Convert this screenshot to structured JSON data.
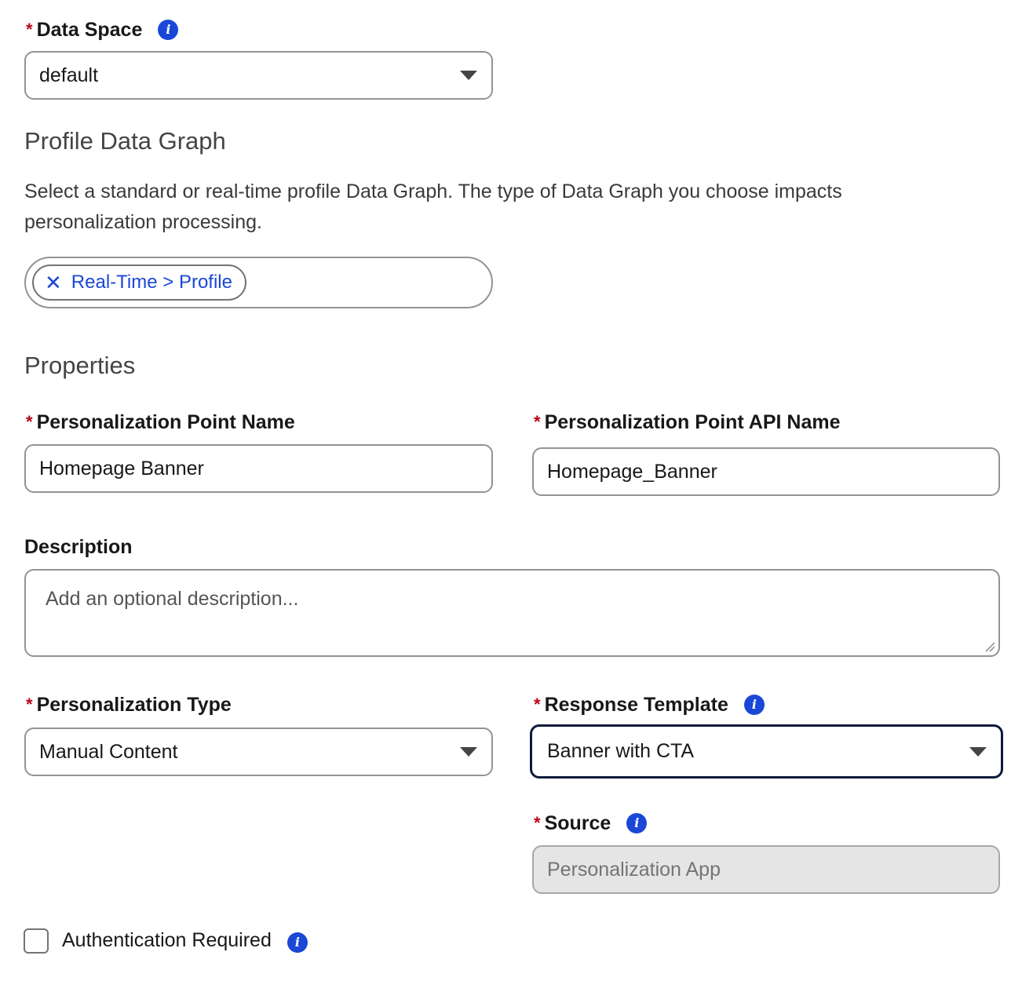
{
  "data_space": {
    "required_mark": "*",
    "label": "Data Space",
    "info_icon": "info-icon",
    "selected": "default"
  },
  "profile_data_graph": {
    "heading": "Profile Data Graph",
    "help_text": "Select a standard or real-time profile Data Graph. The type of Data Graph you choose impacts personalization processing.",
    "selected_pill": "Real-Time > Profile",
    "remove_icon": "close-icon"
  },
  "properties": {
    "heading": "Properties",
    "point_name": {
      "required_mark": "*",
      "label": "Personalization Point Name",
      "value": "Homepage Banner"
    },
    "api_name": {
      "required_mark": "*",
      "label": "Personalization Point API Name",
      "value": "Homepage_Banner"
    },
    "description": {
      "label": "Description",
      "placeholder": "Add an optional description..."
    },
    "personalization_type": {
      "required_mark": "*",
      "label": "Personalization Type",
      "selected": "Manual Content"
    },
    "response_template": {
      "required_mark": "*",
      "label": "Response Template",
      "info_icon": "info-icon",
      "selected": "Banner with CTA"
    },
    "source": {
      "required_mark": "*",
      "label": "Source",
      "info_icon": "info-icon",
      "value": "Personalization App"
    },
    "authentication": {
      "label": "Authentication Required",
      "checked": false,
      "info_icon": "info-icon"
    }
  },
  "colors": {
    "required": "#ba0517",
    "link_blue": "#1b47d6",
    "focus_border": "#0e1a3d",
    "disabled_bg": "#e5e5e5"
  }
}
